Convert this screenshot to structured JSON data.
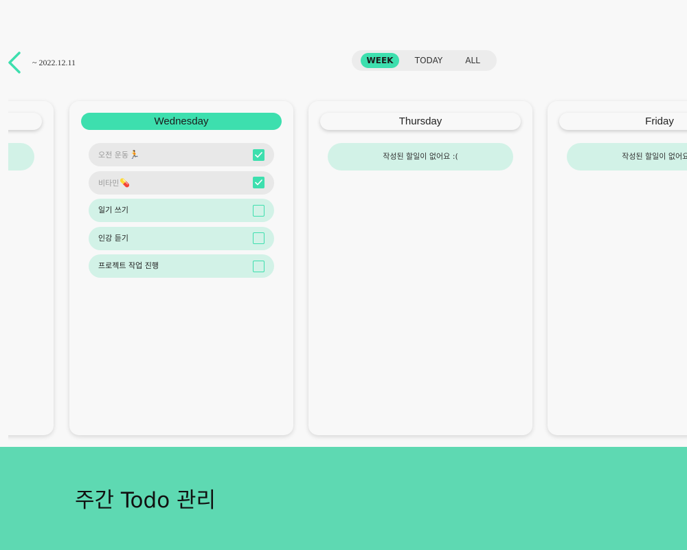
{
  "header": {
    "date_range": "~ 2022.12.11",
    "back_icon": "chevron-left-icon",
    "accent_color": "#3ddfae"
  },
  "view_tabs": [
    {
      "label": "WEEK",
      "selected": true
    },
    {
      "label": "TODAY",
      "selected": false
    },
    {
      "label": "ALL",
      "selected": false
    }
  ],
  "days": {
    "wednesday": {
      "title": "Wednesday",
      "todos": [
        {
          "text": "오전 운동",
          "emoji": "🏃",
          "done": true
        },
        {
          "text": "비타민",
          "emoji": "💊",
          "done": true
        },
        {
          "text": "일기 쓰기",
          "emoji": "",
          "done": false
        },
        {
          "text": "인강 듣기",
          "emoji": "",
          "done": false
        },
        {
          "text": "프로젝트 작업 진행",
          "emoji": "",
          "done": false
        }
      ]
    },
    "thursday": {
      "title": "Thursday",
      "empty_message": "작성된 할일이 없어요 :("
    },
    "friday": {
      "title": "Friday",
      "empty_message": "작성된 할일이 없어요 :("
    }
  },
  "footer": {
    "caption": "주간 Todo 관리",
    "background": "#5ed9b2"
  }
}
